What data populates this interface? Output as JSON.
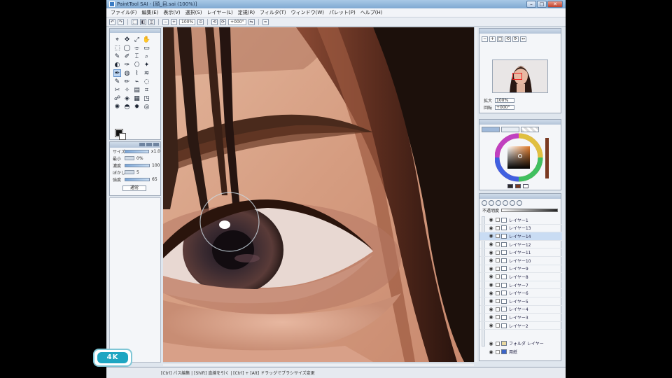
{
  "window": {
    "title": "PaintTool SAI - [顔_目.sai (100%)]"
  },
  "menu": {
    "items": [
      "ファイル(F)",
      "編集(E)",
      "表示(V)",
      "選択(S)",
      "レイヤー(L)",
      "定規(R)",
      "フィルタ(T)",
      "ウィンドウ(W)",
      "パレット(P)",
      "ヘルプ(H)"
    ]
  },
  "commandbar": {
    "zoom_select": "100%",
    "rotate_select": "+000°"
  },
  "tools": {
    "glyphs": [
      "⌖",
      "✥",
      "⤢",
      "✋",
      "⬚",
      "◯",
      "⌯",
      "▭",
      "✎",
      "✐",
      "⌶",
      "⌕",
      "◐",
      "✑",
      "⎔",
      "✦",
      "✒",
      "◍",
      "⌇",
      "≋",
      "✎",
      "✏",
      "⌁",
      "◌",
      "✂",
      "✧",
      "▤",
      "⌗",
      "☍",
      "◈",
      "▦",
      "◳",
      "✺",
      "◓",
      "✹",
      "◎"
    ],
    "active_index": 16
  },
  "tool_options": {
    "rows": [
      {
        "label": "サイズ",
        "value": "x1.0"
      },
      {
        "label": "最小",
        "value": "0%"
      },
      {
        "label": "濃度",
        "value": "100"
      },
      {
        "label": "ぼかし",
        "value": "5"
      },
      {
        "label": "強度",
        "value": "65"
      }
    ],
    "mode": "通常"
  },
  "navigator": {
    "zoom_label": "拡大",
    "zoom_value": "100%",
    "angle_label": "回転",
    "angle_value": "+000°",
    "buttons": [
      "−",
      "+",
      "□",
      "⟲",
      "⟳",
      "↔"
    ]
  },
  "color": {
    "selected": "#7a3a22",
    "swatches": [
      "#2a2a2a",
      "#7a3a22",
      "#ffffff"
    ]
  },
  "layers": {
    "opacity_label": "不透明度",
    "items": [
      {
        "name": "レイヤー1",
        "selected": false
      },
      {
        "name": "レイヤー13",
        "selected": false
      },
      {
        "name": "レイヤー14",
        "selected": true
      },
      {
        "name": "レイヤー12",
        "selected": false
      },
      {
        "name": "レイヤー11",
        "selected": false
      },
      {
        "name": "レイヤー10",
        "selected": false
      },
      {
        "name": "レイヤー9",
        "selected": false
      },
      {
        "name": "レイヤー8",
        "selected": false
      },
      {
        "name": "レイヤー7",
        "selected": false
      },
      {
        "name": "レイヤー6",
        "selected": false
      },
      {
        "name": "レイヤー5",
        "selected": false
      },
      {
        "name": "レイヤー4",
        "selected": false
      },
      {
        "name": "レイヤー3",
        "selected": false
      },
      {
        "name": "レイヤー2",
        "selected": false
      }
    ],
    "folder_name": "フォルダ レイヤー",
    "paper_name": "用紙"
  },
  "status": {
    "text": "[Ctrl] パス編集 | [Shift] 直線を引く | [Ctrl] + [Alt] ドラッグでブラシサイズ変更"
  },
  "badge": {
    "text": "4K"
  }
}
